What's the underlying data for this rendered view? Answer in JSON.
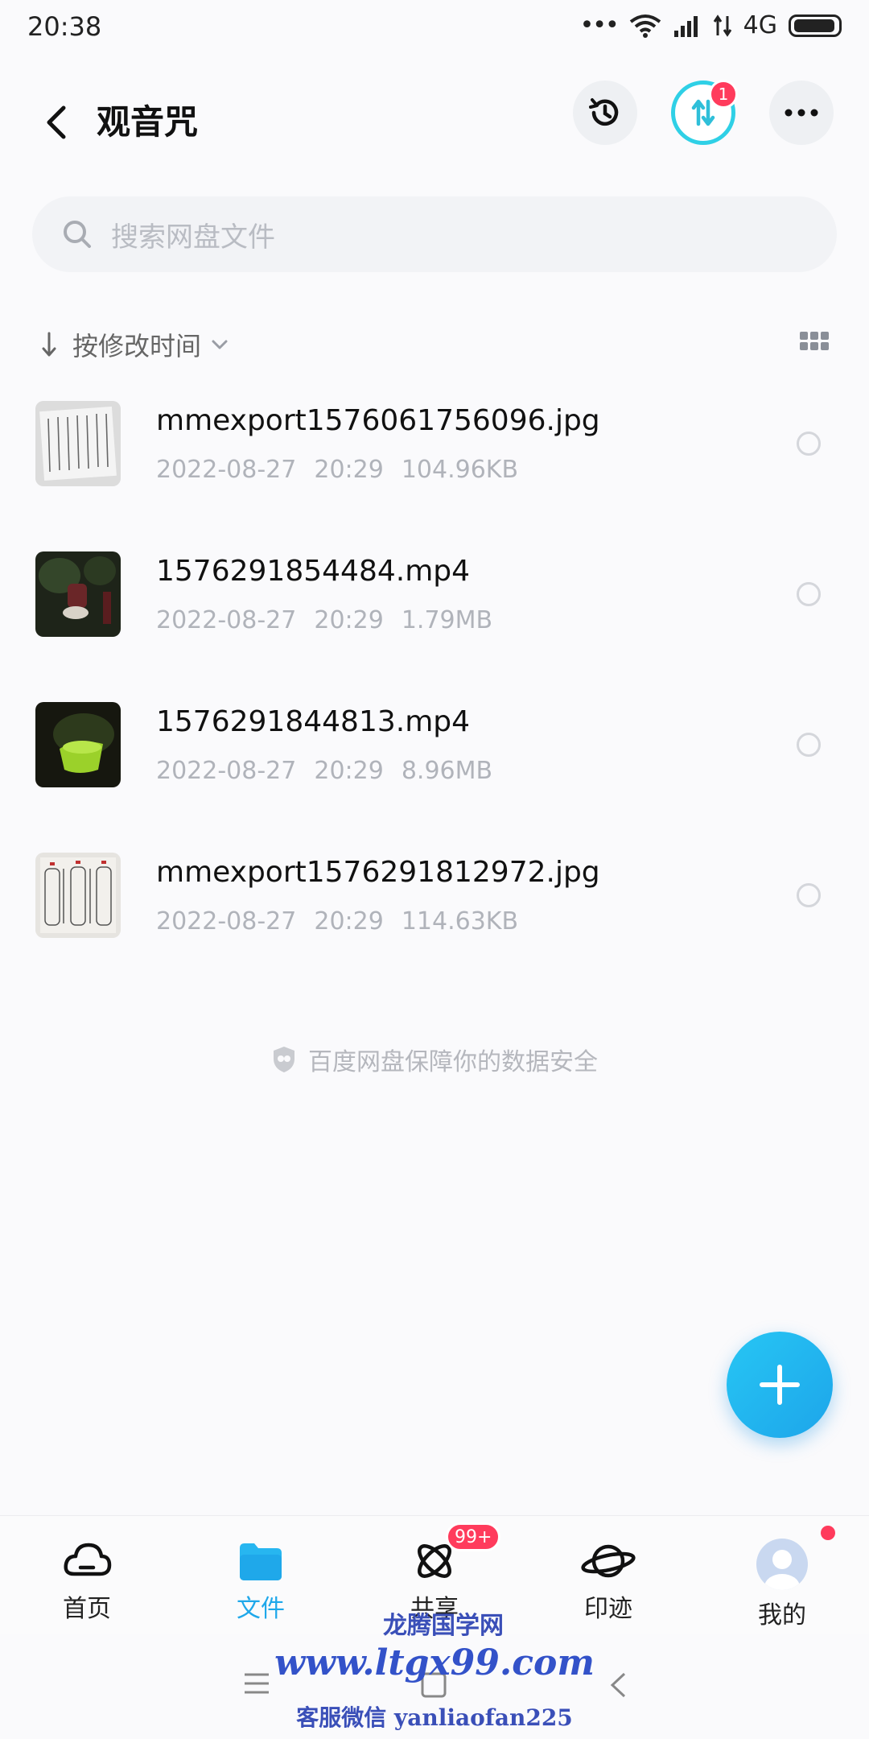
{
  "status_bar": {
    "time": "20:38",
    "network": "4G"
  },
  "header": {
    "title": "观音咒",
    "transfer_badge": "1"
  },
  "search": {
    "placeholder": "搜索网盘文件"
  },
  "sort": {
    "label": "按修改时间"
  },
  "files": [
    {
      "name": "mmexport1576061756096.jpg",
      "date": "2022-08-27",
      "time": "20:29",
      "size": "104.96KB",
      "thumb": "document-photo"
    },
    {
      "name": "1576291854484.mp4",
      "date": "2022-08-27",
      "time": "20:29",
      "size": "1.79MB",
      "thumb": "video-dark"
    },
    {
      "name": "1576291844813.mp4",
      "date": "2022-08-27",
      "time": "20:29",
      "size": "8.96MB",
      "thumb": "video-green"
    },
    {
      "name": "mmexport1576291812972.jpg",
      "date": "2022-08-27",
      "time": "20:29",
      "size": "114.63KB",
      "thumb": "document-photo"
    }
  ],
  "safe_note": "百度网盘保障你的数据安全",
  "bottom_nav": {
    "home": "首页",
    "files": "文件",
    "share": "共享",
    "share_badge": "99+",
    "moments": "印迹",
    "mine": "我的"
  },
  "watermark": {
    "line1": "龙腾国学网",
    "line2": "www.ltgx99.com",
    "line3": "客服微信 yanliaofan225"
  },
  "colors": {
    "accent": "#1fa8ea",
    "badge": "#ff3b5c",
    "transfer_ring": "#2fd0e6"
  }
}
